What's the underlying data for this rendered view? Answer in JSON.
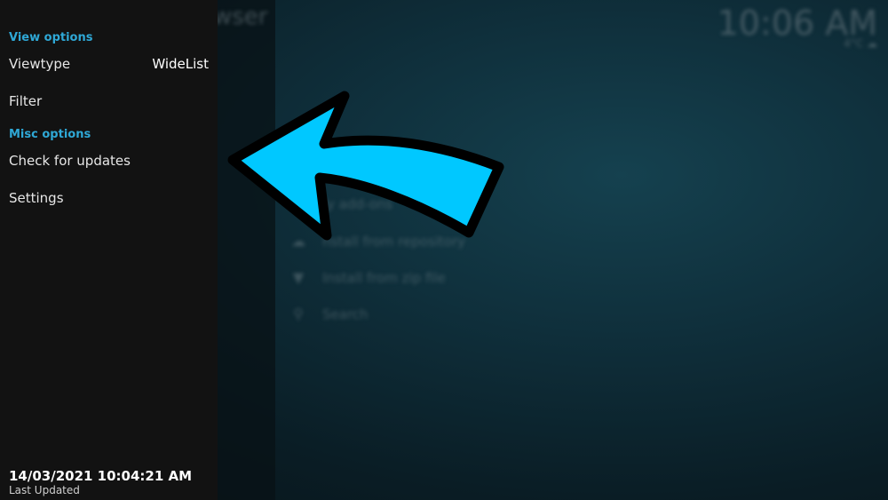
{
  "background": {
    "title": "wser",
    "clock": "10:06 AM",
    "weather": "4°C",
    "items": [
      {
        "icon": "refresh-icon",
        "label": "fy add-ons"
      },
      {
        "icon": "cloud-download-icon",
        "label": "nstall from repository"
      },
      {
        "icon": "zip-icon",
        "label": "Install from zip file"
      },
      {
        "icon": "search-icon",
        "label": "Search"
      }
    ]
  },
  "side_menu": {
    "view_options_header": "View options",
    "viewtype_label": "Viewtype",
    "viewtype_value": "WideList",
    "filter_label": "Filter",
    "misc_options_header": "Misc options",
    "check_updates_label": "Check for updates",
    "settings_label": "Settings",
    "last_updated_value": "14/03/2021 10:04:21 AM",
    "last_updated_label": "Last Updated"
  },
  "colors": {
    "accent": "#2fa8d6",
    "arrow_fill": "#00c8ff",
    "arrow_outline": "#000000"
  }
}
